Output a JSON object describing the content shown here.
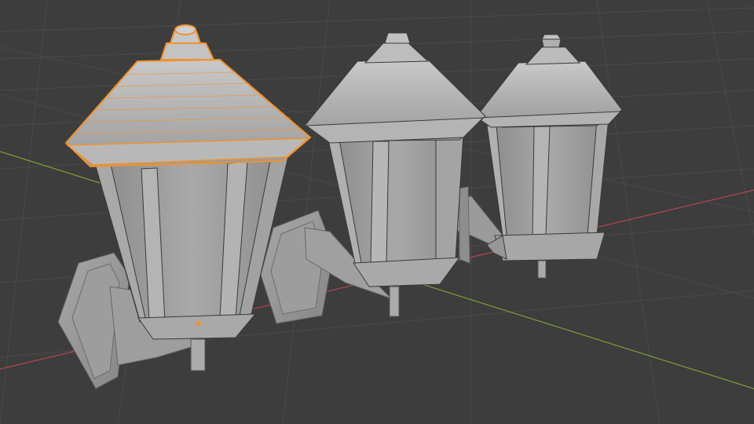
{
  "viewport": {
    "background": "#3d3d3d",
    "grid_color": "#4a4a4a",
    "x_axis_color": "#b5454f",
    "y_axis_color": "#7f9f3a",
    "selection_color": "#f0922e"
  },
  "scene": {
    "objects": [
      {
        "name": "lantern-selected",
        "selected": true
      },
      {
        "name": "lantern-middle",
        "selected": false
      },
      {
        "name": "lantern-right",
        "selected": false
      }
    ]
  }
}
